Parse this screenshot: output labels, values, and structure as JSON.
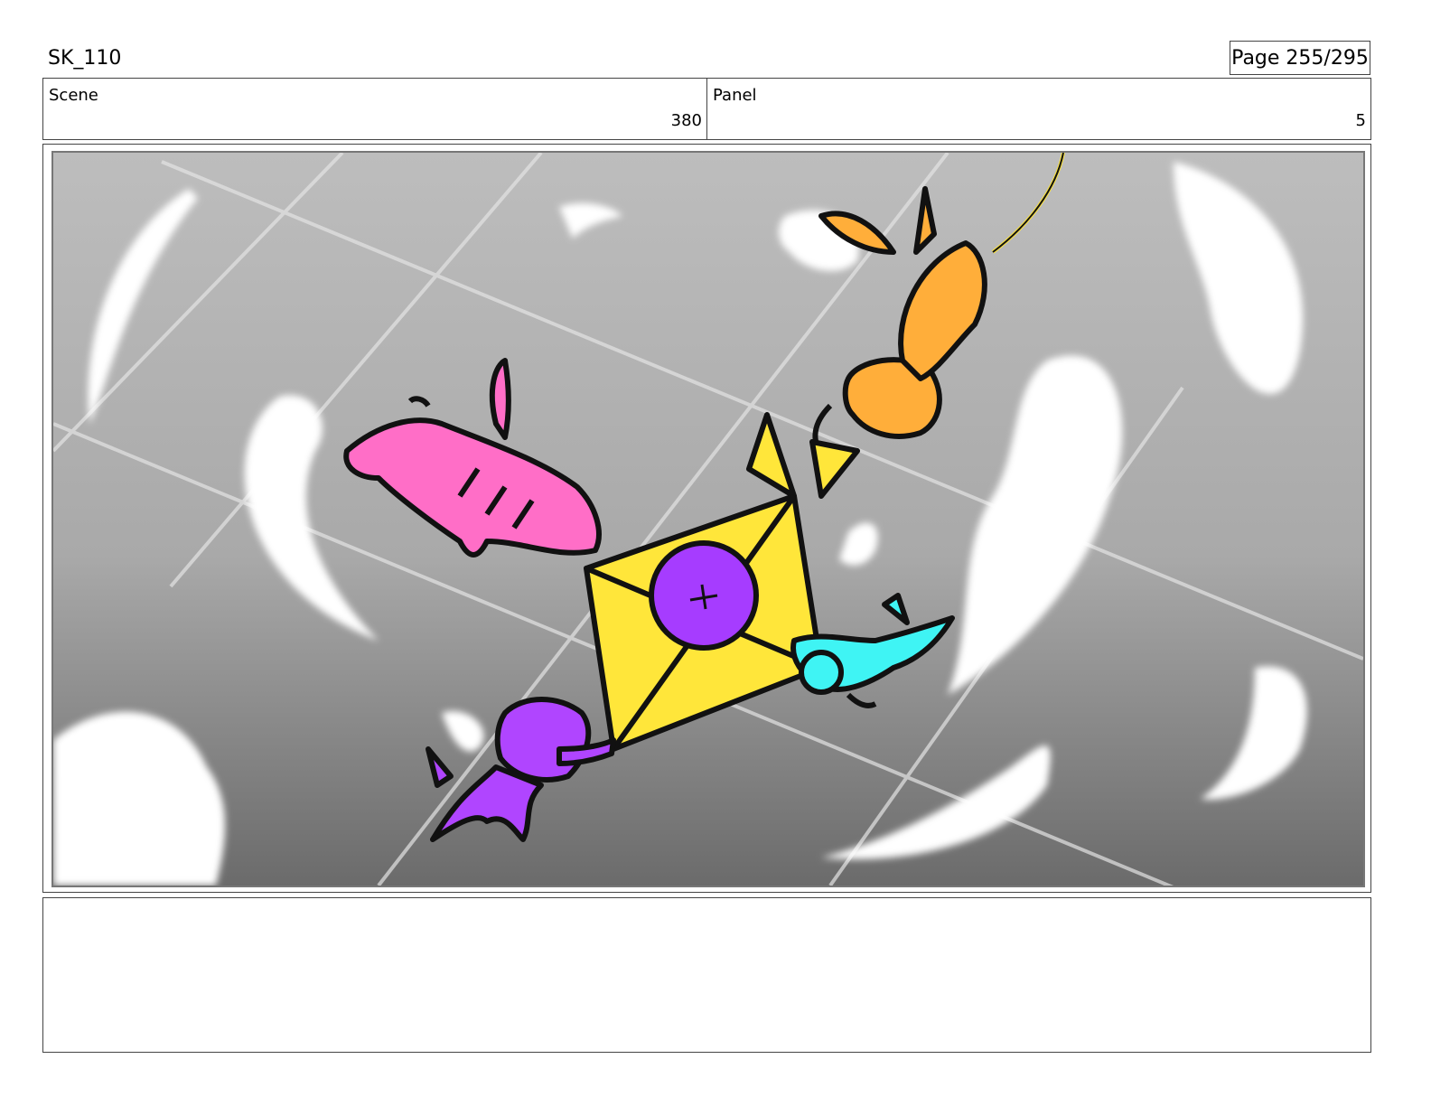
{
  "header": {
    "project_id": "SK_110",
    "page_label": "Page 255/295"
  },
  "info": {
    "scene_label": "Scene",
    "scene_value": "380",
    "panel_label": "Panel",
    "panel_value": "5"
  },
  "artwork": {
    "colors": {
      "sky_light": "#bdbdbd",
      "sky_dark": "#6b6b6b",
      "cloud": "#ffffff",
      "pink_creature": "#ff6ec7",
      "orange_creature": "#ffae3a",
      "cyan_creature": "#3ff4f4",
      "purple_creature": "#b045ff",
      "kite": "#ffe63a",
      "kite_button": "#a63cff",
      "ink": "#111111"
    }
  },
  "notes": {
    "text": ""
  }
}
